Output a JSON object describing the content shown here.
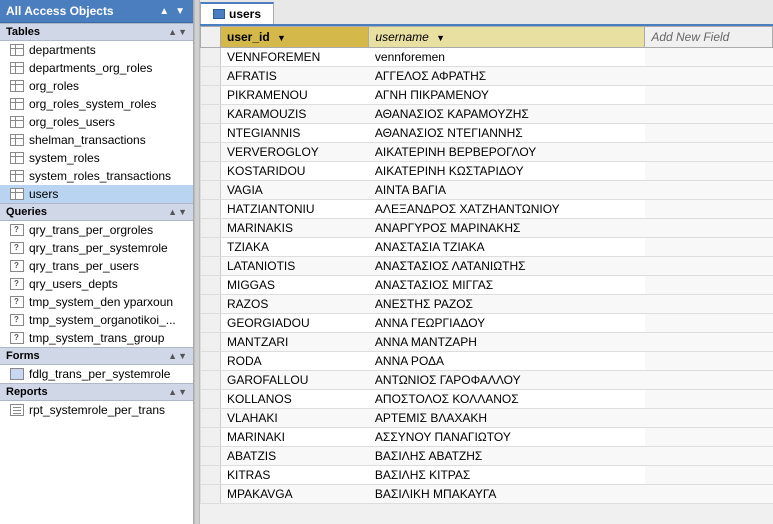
{
  "leftPanel": {
    "header": "All Access Objects",
    "sections": [
      {
        "name": "Tables",
        "items": [
          "departments",
          "departments_org_roles",
          "org_roles",
          "org_roles_system_roles",
          "org_roles_users",
          "shelman_transactions",
          "system_roles",
          "system_roles_transactions",
          "users"
        ],
        "selectedItem": "users"
      },
      {
        "name": "Queries",
        "items": [
          "qry_trans_per_orgroles",
          "qry_trans_per_systemrole",
          "qry_trans_per_users",
          "qry_users_depts",
          "tmp_system_den yparxoun",
          "tmp_system_organotikoi_...",
          "tmp_system_trans_group"
        ]
      },
      {
        "name": "Forms",
        "items": [
          "fdlg_trans_per_systemrole"
        ]
      },
      {
        "name": "Reports",
        "items": [
          "rpt_systemrole_per_trans"
        ]
      }
    ]
  },
  "tabBar": {
    "tabs": [
      {
        "label": "users",
        "active": true,
        "type": "table"
      }
    ]
  },
  "grid": {
    "columns": [
      {
        "id": "row_selector",
        "label": ""
      },
      {
        "id": "user_id",
        "label": "user_id",
        "sortable": true
      },
      {
        "id": "username",
        "label": "username",
        "sortable": true
      },
      {
        "id": "add_new",
        "label": "Add New Field"
      }
    ],
    "rows": [
      {
        "user_id": "VENNFOREMEN",
        "username": "vennforemen"
      },
      {
        "user_id": "AFRATIS",
        "username": "ΑΓΓΕΛΟΣ ΑΦΡΑΤΗΣ"
      },
      {
        "user_id": "PIKRAMENOU",
        "username": "ΑΓΝΗ ΠΙΚΡΑΜΕΝΟΥ"
      },
      {
        "user_id": "KARAMOUZIS",
        "username": "ΑΘΑΝΑΣΙΟΣ ΚΑΡΑΜΟΥΖΗΣ"
      },
      {
        "user_id": "NTEGIANNIS",
        "username": "ΑΘΑΝΑΣΙΟΣ ΝΤΕΓΙΑΝΝΗΣ"
      },
      {
        "user_id": "VERVEROGLOY",
        "username": "ΑΙΚΑΤΕΡΙΝΗ ΒΕΡΒΕΡΟΓΛΟΥ"
      },
      {
        "user_id": "KOSTARIDOU",
        "username": "ΑΙΚΑΤΕΡΙΝΗ ΚΩΣΤΑΡΙΔΟΥ"
      },
      {
        "user_id": "VAGIA",
        "username": "ΑΙΝΤΑ ΒΑΓΙΑ"
      },
      {
        "user_id": "HATZIANTONIU",
        "username": "ΑΛΕΞΑΝΔΡΟΣ ΧΑΤΖΗΑΝΤΩΝΙΟΥ"
      },
      {
        "user_id": "MARINAKIS",
        "username": "ΑΝΑΡΓΥΡΟΣ ΜΑΡΙΝΑΚΗΣ"
      },
      {
        "user_id": "TZIAKA",
        "username": "ΑΝΑΣΤΑΣΙΑ ΤΖΙΑΚΑ"
      },
      {
        "user_id": "LATANIOTIS",
        "username": "ΑΝΑΣΤΑΣΙΟΣ ΛΑΤΑΝΙΩΤΗΣ"
      },
      {
        "user_id": "MIGGAS",
        "username": "ΑΝΑΣΤΑΣΙΟΣ ΜΙΓΓΑΣ"
      },
      {
        "user_id": "RAZOS",
        "username": "ΑΝΕΣΤΗΣ ΡΑΖΟΣ"
      },
      {
        "user_id": "GEORGIADOU",
        "username": "ΑΝΝΑ ΓΕΩΡΓΙΑΔΟΥ"
      },
      {
        "user_id": "MANTZARI",
        "username": "ΑΝΝΑ ΜΑΝΤΖΑΡΗ"
      },
      {
        "user_id": "RODA",
        "username": "ΑΝΝΑ ΡΟΔΑ"
      },
      {
        "user_id": "GAROFALLOU",
        "username": "ΑΝΤΩΝΙΟΣ ΓΑΡΟΦΑΛΛΟΥ"
      },
      {
        "user_id": "KOLLANOS",
        "username": "ΑΠΟΣΤΟΛΟΣ ΚΟΛΛΑΝΟΣ"
      },
      {
        "user_id": "VLAHAKI",
        "username": "ΑΡΤΕΜΙΣ ΒΛΑΧΑΚΗ"
      },
      {
        "user_id": "MARINAKI",
        "username": "ΑΣΣΥΝΟΥ ΠΑΝΑΓΙΩΤΟΥ"
      },
      {
        "user_id": "ABATZIS",
        "username": "ΒΑΣΙΛΗΣ ΑΒΑΤΖΗΣ"
      },
      {
        "user_id": "KITRAS",
        "username": "ΒΑΣΙΛΗΣ ΚΙΤΡΑΣ"
      },
      {
        "user_id": "MPAKAVGA",
        "username": "ΒΑΣΙΛΙΚΗ ΜΠΑΚΑΥΓΑ"
      }
    ]
  },
  "colors": {
    "headerBg": "#4a7ebf",
    "tabActive": "#ffffff",
    "userIdHeader": "#d4b84a",
    "usernameHeader": "#e8e0a0",
    "sectionHeaderBg": "#d0d8e8"
  }
}
